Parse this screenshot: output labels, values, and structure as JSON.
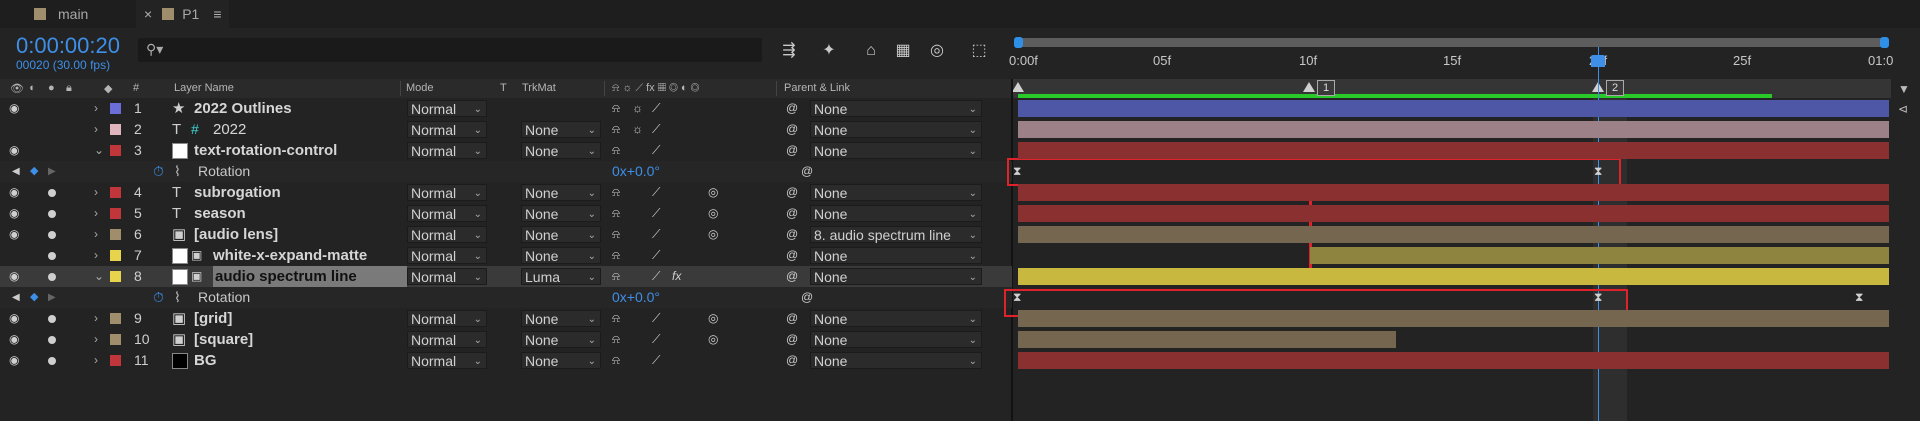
{
  "tabs": [
    {
      "label": "main",
      "color": "#a08d6c"
    },
    {
      "label": "P1",
      "color": "#a08d6c"
    }
  ],
  "header": {
    "timecode": "0:00:00:20",
    "frames": "00020 (30.00 fps)",
    "search_placeholder": ""
  },
  "ruler": {
    "ticks": [
      "0:00f",
      "05f",
      "10f",
      "15f",
      "20f",
      "25f",
      "01:0"
    ],
    "markers": [
      "1",
      "2"
    ]
  },
  "columns": {
    "layer_name": "Layer Name",
    "mode": "Mode",
    "t": "T",
    "trkmat": "TrkMat",
    "parent": "Parent & Link"
  },
  "layers": [
    {
      "num": "1",
      "name": "2022 Outlines",
      "mode": "Normal",
      "trkmat": "",
      "parent": "None",
      "label": "#6a6ed6",
      "type": "star",
      "bar": "#4e56a6",
      "barstart": 1018,
      "bold": true
    },
    {
      "num": "2",
      "name": "2022",
      "mode": "Normal",
      "trkmat": "None",
      "parent": "None",
      "label": "#e0b4bc",
      "type": "text",
      "bar": "#9c8288",
      "barstart": 1018,
      "bold": false
    },
    {
      "num": "3",
      "name": "text-rotation-control",
      "mode": "Normal",
      "trkmat": "None",
      "parent": "None",
      "label": "#c0363a",
      "type": "solid",
      "bar": "#8a3030",
      "barstart": 1018,
      "bold": true
    },
    {
      "num": "4",
      "name": "subrogation",
      "mode": "Normal",
      "trkmat": "None",
      "parent": "None",
      "label": "#c0363a",
      "type": "text",
      "bar": "#8a3030",
      "barstart": 1018,
      "bold": true
    },
    {
      "num": "5",
      "name": "season",
      "mode": "Normal",
      "trkmat": "None",
      "parent": "None",
      "label": "#c0363a",
      "type": "text",
      "bar": "#8a3030",
      "barstart": 1018,
      "bold": true
    },
    {
      "num": "6",
      "name": "[audio lens]",
      "mode": "Normal",
      "trkmat": "None",
      "parent": "8. audio spectrum line",
      "label": "#a08d6c",
      "type": "comp",
      "bar": "#74664f",
      "barstart": 1018,
      "bold": true
    },
    {
      "num": "7",
      "name": "white-x-expand-matte",
      "mode": "Normal",
      "trkmat": "None",
      "parent": "None",
      "label": "#e8d44c",
      "type": "solid",
      "bar": "#8e8440",
      "barstart": 1310,
      "bold": true
    },
    {
      "num": "8",
      "name": "audio spectrum line",
      "mode": "Normal",
      "trkmat": "Luma",
      "parent": "None",
      "label": "#e8d44c",
      "type": "solid",
      "bar": "#c8b840",
      "barstart": 1018,
      "bold": true
    },
    {
      "num": "9",
      "name": "[grid]",
      "mode": "Normal",
      "trkmat": "None",
      "parent": "None",
      "label": "#a08d6c",
      "type": "comp",
      "bar": "#74664f",
      "barstart": 1018,
      "bold": true
    },
    {
      "num": "10",
      "name": "[square]",
      "mode": "Normal",
      "trkmat": "None",
      "parent": "None",
      "label": "#a08d6c",
      "type": "comp",
      "bar": "#74664f",
      "barstart": 1018,
      "bold": true
    },
    {
      "num": "11",
      "name": "BG",
      "mode": "Normal",
      "trkmat": "None",
      "parent": "None",
      "label": "#c0363a",
      "type": "solid",
      "bar": "#8a3030",
      "barstart": 1018,
      "bold": true
    }
  ],
  "properties": [
    {
      "name": "Rotation",
      "value": "0x+0.0°"
    },
    {
      "name": "Rotation",
      "value": "0x+0.0°"
    }
  ]
}
